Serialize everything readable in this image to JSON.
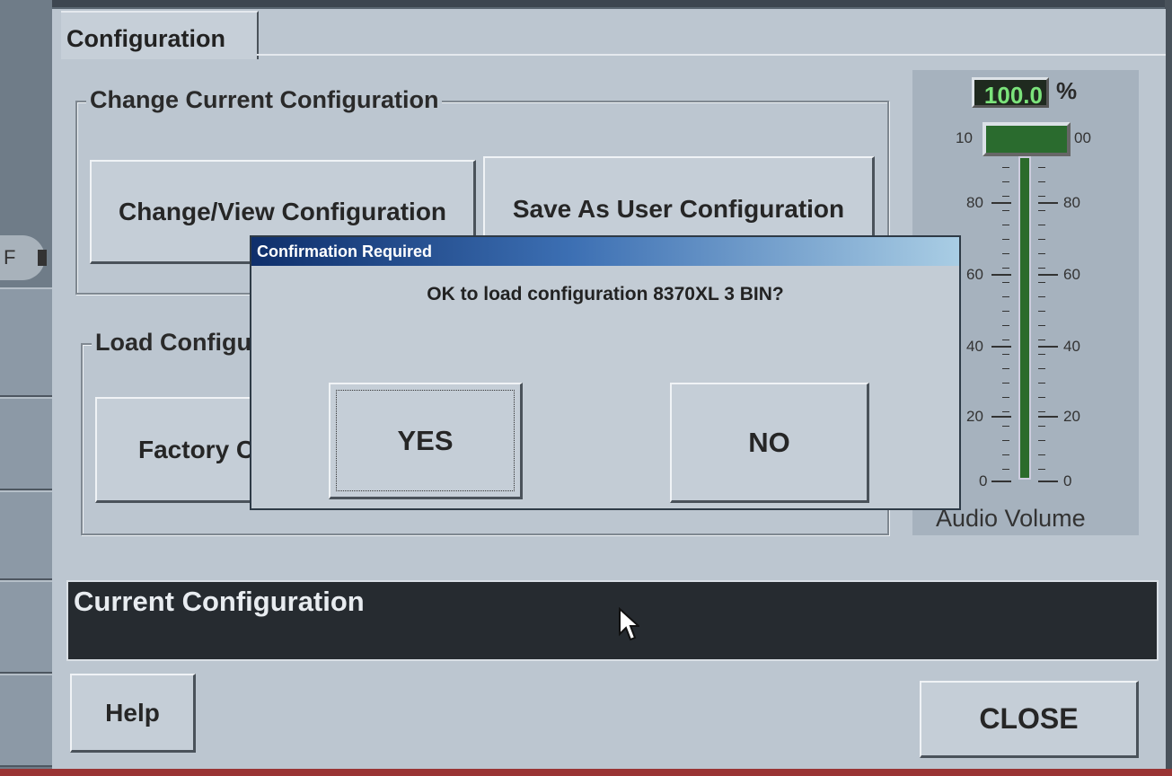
{
  "window": {
    "tab_label": "Configuration"
  },
  "change_group": {
    "title": "Change Current Configuration",
    "change_view_label": "Change/View Configuration",
    "save_user_label": "Save As User Configuration"
  },
  "load_group": {
    "title": "Load Configuration",
    "factory_label": "Factory Configuration"
  },
  "volume": {
    "readout": "100.0",
    "unit": "%",
    "value_percent": 100,
    "thumb_left_label": "10",
    "thumb_right_label": "00",
    "ticks": [
      "80",
      "60",
      "40",
      "20",
      "0"
    ],
    "title": "Audio Volume"
  },
  "current_bar": {
    "label": "Current Configuration"
  },
  "footer": {
    "help_label": "Help",
    "close_label": "CLOSE"
  },
  "dialog": {
    "title": "Confirmation Required",
    "message": "OK to load configuration 8370XL 3 BIN?",
    "yes_label": "YES",
    "no_label": "NO"
  },
  "left_strip": {
    "off_label": "F"
  },
  "colors": {
    "window_bg": "#bcc6d0",
    "title_bar": "#0f2f6b",
    "readout_text": "#7be37b",
    "slider_fill": "#2b6b2b"
  }
}
